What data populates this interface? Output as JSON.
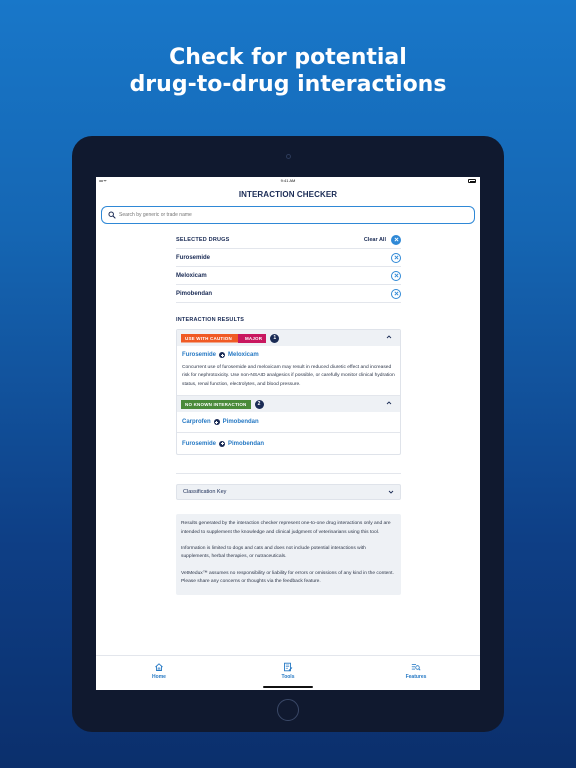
{
  "headline": {
    "line1": "Check for potential",
    "line2": "drug-to-drug interactions"
  },
  "status_bar": {
    "time": "9:41 AM",
    "signal": "•••• ᯤ"
  },
  "nav": {
    "title": "INTERACTION CHECKER"
  },
  "search": {
    "placeholder": "Search by generic or trade name"
  },
  "selected": {
    "title": "SELECTED DRUGS",
    "clear_label": "Clear All",
    "drugs": [
      "Furosemide",
      "Meloxicam",
      "Pimobendan"
    ]
  },
  "results": {
    "title": "INTERACTION RESULTS",
    "caution_group": {
      "badge_caution": "USE WITH CAUTION",
      "badge_major": "MAJOR",
      "count": "1",
      "pair": {
        "a": "Furosemide",
        "b": "Meloxicam"
      },
      "description": "Concurrent use of furosemide and meloxicam may result in reduced diuretic effect and increased risk for nephrotoxicity. Use non-NSAID analgesics if possible, or carefully monitor clinical hydration status, renal function, electrolytes, and blood pressure."
    },
    "none_group": {
      "badge": "NO KNOWN INTERACTION",
      "count": "2",
      "pairs": [
        {
          "a": "Carprofen",
          "b": "Pimobendan"
        },
        {
          "a": "Furosemide",
          "b": "Pimobendan"
        }
      ]
    }
  },
  "classification_key": {
    "label": "Classification Key"
  },
  "disclaimer": {
    "p1": "Results generated by the interaction checker represent one-to-one drug interactions only and are intended to supplement the knowledge and clinical judgment of veterinarians using this tool.",
    "p2": "Information is limited to dogs and cats and does not include potential interactions with supplements, herbal therapies, or nutraceuticals.",
    "p3": "VetMedux™ assumes no responsibility or liability for errors or omissions of any kind in the content. Please share any concerns or thoughts via the feedback feature."
  },
  "tabs": [
    {
      "label": "Home",
      "icon": "home-icon"
    },
    {
      "label": "Tools",
      "icon": "tools-icon"
    },
    {
      "label": "Features",
      "icon": "features-icon"
    }
  ],
  "colors": {
    "accent": "#2e88d6",
    "navy": "#1a2b55",
    "caution": "#f05a24",
    "major": "#c8175f",
    "no_interaction": "#4a8a3a"
  }
}
